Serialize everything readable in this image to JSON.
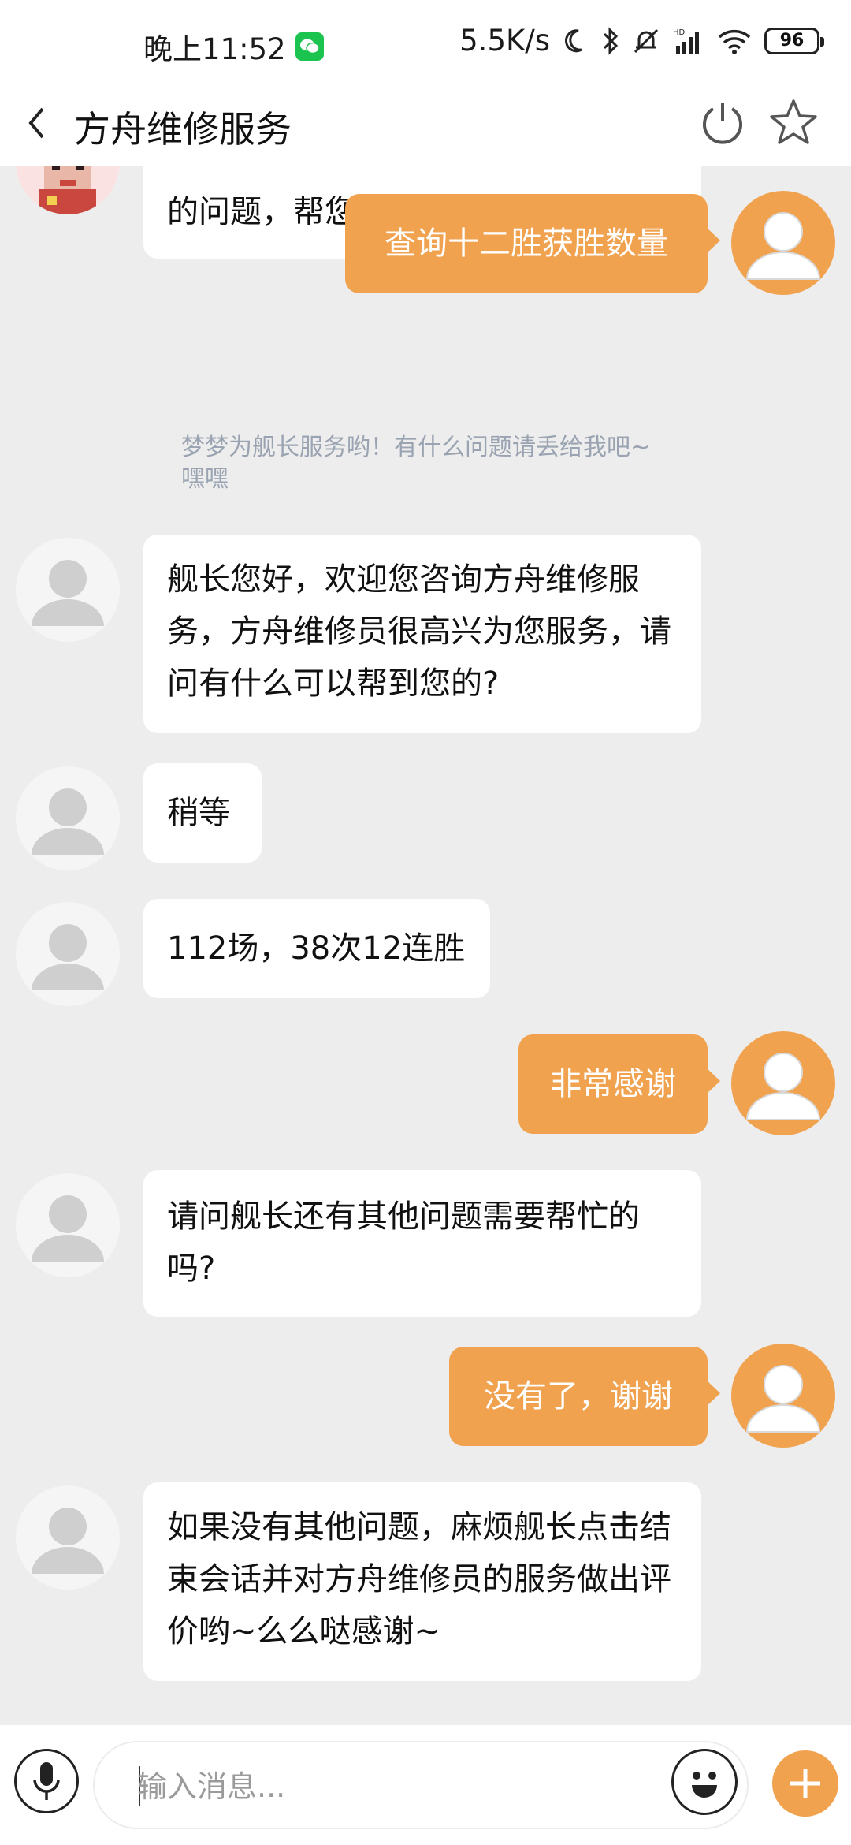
{
  "status_bar": {
    "time": "晚上11:52",
    "net_speed": "5.5K/s",
    "battery": "96",
    "icons": [
      "wechat-icon",
      "moon-icon",
      "bluetooth-icon",
      "mute-bell-icon",
      "signal-hd-icon",
      "wifi-icon",
      "battery-icon"
    ]
  },
  "header": {
    "title": "方舟维修服务",
    "icons": [
      "back-chevron-icon",
      "power-icon",
      "star-icon"
    ]
  },
  "messages": [
    {
      "from": "agent",
      "text": "舰长遇到什么问题啦！请描述您的问题，帮您找方舟维修员哦~",
      "visible_text": "的问题，帮您找方舟维修员哦~"
    },
    {
      "from": "user",
      "text": "查询十二胜获胜数量"
    },
    {
      "from": "system",
      "text": "梦梦为舰长服务哟！有什么问题请丢给我吧~嘿嘿"
    },
    {
      "from": "agent",
      "text": "舰长您好，欢迎您咨询方舟维修服务，方舟维修员很高兴为您服务，请问有什么可以帮到您的?"
    },
    {
      "from": "agent",
      "text": "稍等"
    },
    {
      "from": "agent",
      "text": "112场，38次12连胜"
    },
    {
      "from": "user",
      "text": "非常感谢"
    },
    {
      "from": "agent",
      "text": "请问舰长还有其他问题需要帮忙的吗?"
    },
    {
      "from": "user",
      "text": "没有了，谢谢"
    },
    {
      "from": "agent",
      "text": "如果没有其他问题，麻烦舰长点击结束会话并对方舟维修员的服务做出评价哟~么么哒感谢~"
    }
  ],
  "input": {
    "placeholder": "输入消息..."
  },
  "colors": {
    "accent": "#f0a24f",
    "background": "#ededed",
    "bubble_in": "#ffffff",
    "system_text": "#9aa3b1"
  }
}
